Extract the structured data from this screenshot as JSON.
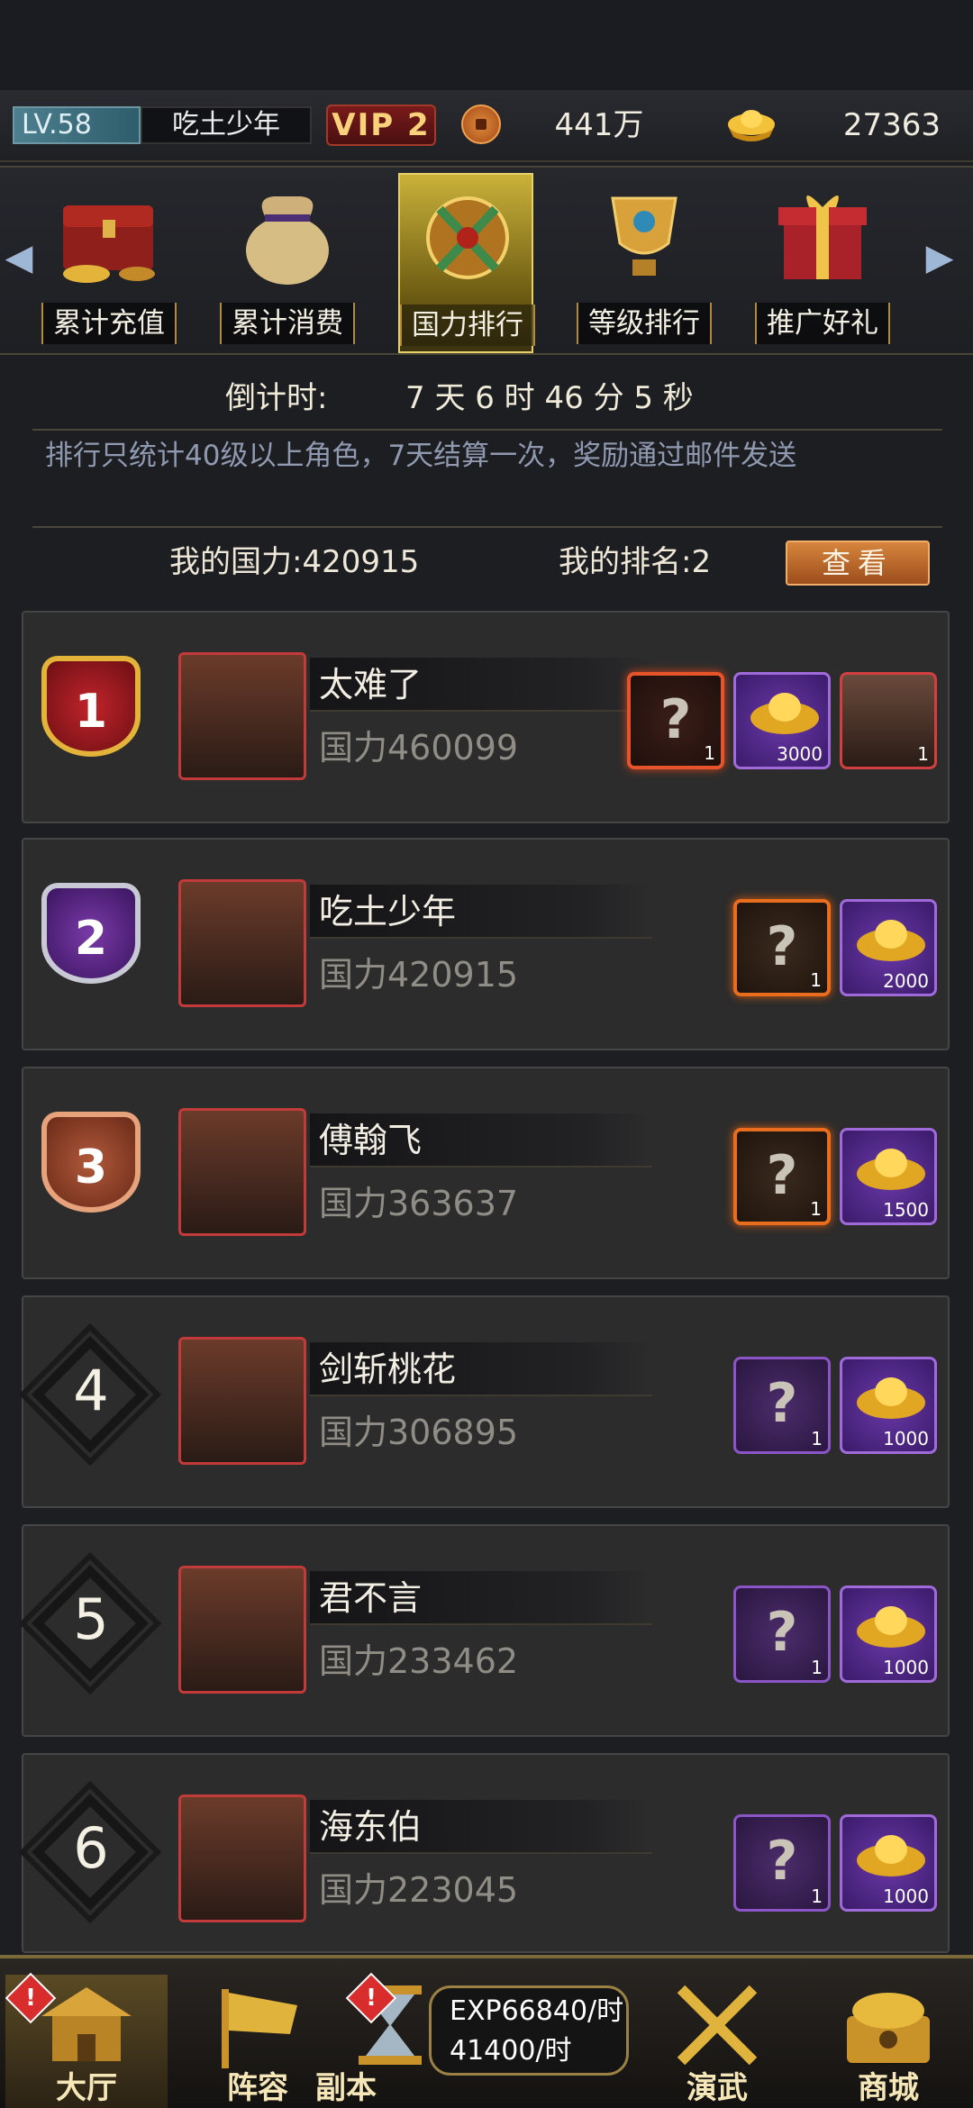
{
  "player": {
    "level": "LV.58",
    "name": "吃土少年",
    "vip": "VIP 2"
  },
  "currency": {
    "copper": "441万",
    "gold": "27363"
  },
  "tabs": [
    {
      "label": "累计充值",
      "active": false
    },
    {
      "label": "累计消费",
      "active": false
    },
    {
      "label": "国力排行",
      "active": true
    },
    {
      "label": "等级排行",
      "active": false
    },
    {
      "label": "推广好礼",
      "active": false
    }
  ],
  "countdown": {
    "label": "倒计时:",
    "value": "7 天 6 时 46 分 5 秒"
  },
  "notice": "排行只统计40级以上角色，7天结算一次，奖励通过邮件发送",
  "my_power": "我的国力:420915",
  "my_rank": "我的排名:2",
  "view_button": "查看",
  "rankings": [
    {
      "rank": "1",
      "name": "太难了",
      "power": "国力460099",
      "rewards": [
        {
          "type": "mystery",
          "count": "1"
        },
        {
          "type": "gold",
          "count": "3000"
        },
        {
          "type": "hero",
          "count": "1"
        }
      ]
    },
    {
      "rank": "2",
      "name": "吃土少年",
      "power": "国力420915",
      "rewards": [
        {
          "type": "mystery",
          "count": "1"
        },
        {
          "type": "gold",
          "count": "2000"
        }
      ]
    },
    {
      "rank": "3",
      "name": "傅翰飞",
      "power": "国力363637",
      "rewards": [
        {
          "type": "mystery",
          "count": "1"
        },
        {
          "type": "gold",
          "count": "1500"
        }
      ]
    },
    {
      "rank": "4",
      "name": "剑斩桃花",
      "power": "国力306895",
      "rewards": [
        {
          "type": "mystery",
          "count": "1"
        },
        {
          "type": "gold",
          "count": "1000"
        }
      ]
    },
    {
      "rank": "5",
      "name": "君不言",
      "power": "国力233462",
      "rewards": [
        {
          "type": "mystery",
          "count": "1"
        },
        {
          "type": "gold",
          "count": "1000"
        }
      ]
    },
    {
      "rank": "6",
      "name": "海东伯",
      "power": "国力223045",
      "rewards": [
        {
          "type": "mystery",
          "count": "1"
        },
        {
          "type": "gold",
          "count": "1000"
        }
      ]
    }
  ],
  "nav": [
    {
      "label": "大厅",
      "active": true,
      "alert": true
    },
    {
      "label": "阵容",
      "active": false,
      "alert": false
    },
    {
      "label": "副本",
      "active": false,
      "alert": true
    },
    {
      "label": "演武",
      "active": false,
      "alert": false
    },
    {
      "label": "商城",
      "active": false,
      "alert": false
    }
  ],
  "exp_rate": "EXP66840/时",
  "copper_rate": "41400/时",
  "alert_mark": "!",
  "reward_mark": "?"
}
